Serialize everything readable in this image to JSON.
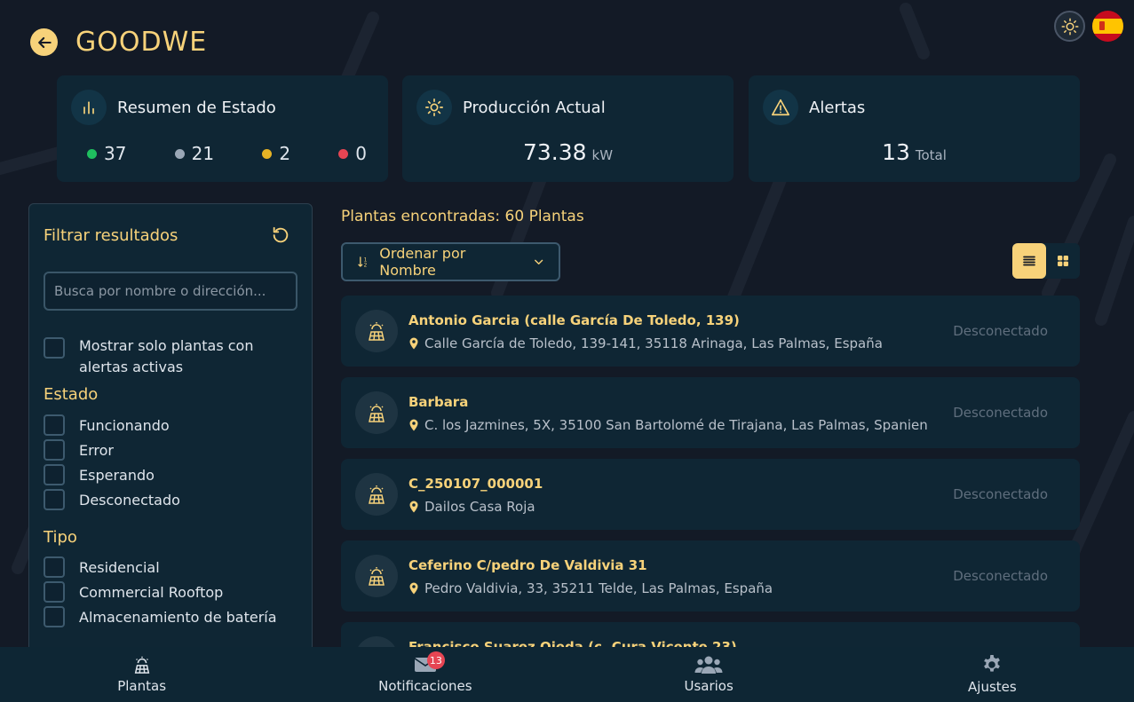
{
  "header": {
    "brand": "GOODWE"
  },
  "summary": {
    "status": {
      "title": "Resumen de Estado",
      "items": [
        {
          "value": "37",
          "color": "#1fbf5f"
        },
        {
          "value": "21",
          "color": "#9aa7b6"
        },
        {
          "value": "2",
          "color": "#e6b325"
        },
        {
          "value": "0",
          "color": "#e64553"
        }
      ]
    },
    "production": {
      "title": "Producción Actual",
      "value": "73.38",
      "unit": "kW"
    },
    "alerts": {
      "title": "Alertas",
      "value": "13",
      "unit": "Total"
    }
  },
  "filter": {
    "title": "Filtrar resultados",
    "search_placeholder": "Busca por nombre o dirección...",
    "only_alerts": "Mostrar solo plantas con alertas activas",
    "estado_label": "Estado",
    "estado": [
      "Funcionando",
      "Error",
      "Esperando",
      "Desconectado"
    ],
    "tipo_label": "Tipo",
    "tipo": [
      "Residencial",
      "Commercial Rooftop",
      "Almacenamiento de batería"
    ]
  },
  "list": {
    "found": "Plantas encontradas: 60 Plantas",
    "sort_label": "Ordenar por Nombre",
    "plants": [
      {
        "name": "Antonio Garcia (calle García De Toledo, 139)",
        "address": "Calle García de Toledo, 139-141, 35118 Arinaga, Las Palmas, España",
        "status": "Desconectado"
      },
      {
        "name": "Barbara",
        "address": "C. los Jazmines, 5X, 35100 San Bartolomé de Tirajana, Las Palmas, Spanien",
        "status": "Desconectado"
      },
      {
        "name": "C_250107_000001",
        "address": "Dailos Casa Roja",
        "status": "Desconectado"
      },
      {
        "name": "Ceferino C/pedro De Valdivia 31",
        "address": "Pedro Valdivia, 33, 35211 Telde, Las Palmas, España",
        "status": "Desconectado"
      },
      {
        "name": "Francisco Suarez Ojeda (c. Cura Vicente 23)",
        "address": "",
        "status": ""
      }
    ]
  },
  "nav": {
    "items": [
      {
        "label": "Plantas"
      },
      {
        "label": "Notificaciones",
        "badge": "13"
      },
      {
        "label": "Usarios"
      },
      {
        "label": "Ajustes"
      }
    ]
  }
}
